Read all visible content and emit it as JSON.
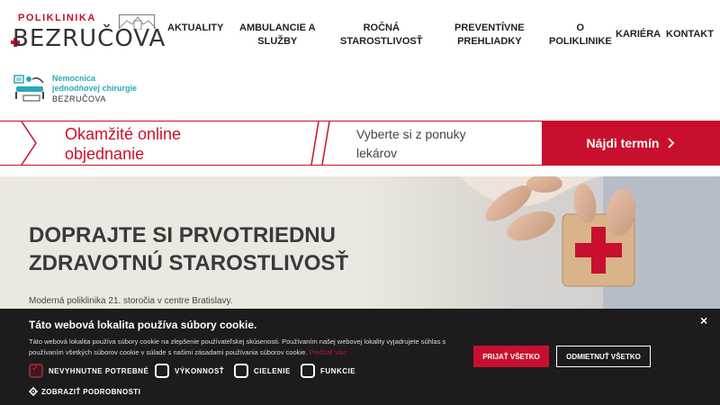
{
  "header": {
    "logo_top": "POLIKLINIKA",
    "logo_main": "BEZRUČOVA",
    "nav": [
      {
        "label": "AKTUALITY"
      },
      {
        "label": "AMBULANCIE A\nSLUŽBY"
      },
      {
        "label": "ROČNÁ\nSTAROSTLIVOSŤ"
      },
      {
        "label": "PREVENTÍVNE\nPREHLIADKY"
      },
      {
        "label": "O\nPOLIKLINIKE"
      },
      {
        "label": "KARIÉRA"
      },
      {
        "label": "KONTAKT"
      }
    ]
  },
  "sublogo": {
    "line1": "Nemocnica",
    "line2": "jednodňovej chirurgie",
    "line3": "BEZRUČOVA"
  },
  "booking": {
    "title": "Okamžité online\nobjednanie",
    "select_label": "Vyberte si z ponuky\nlekárov",
    "button_label": "Nájdi termín",
    "button_icon": "chevron-right-icon"
  },
  "hero": {
    "title": "DOPRAJTE SI PRVOTRIEDNU\nZDRAVOTNÚ STAROSTLIVOSŤ",
    "subtitle": "Moderná poliklinika 21. storočia v centre Bratislavy."
  },
  "cookie": {
    "title": "Táto webová lokalita používa súbory cookie.",
    "text": "Táto webová lokalita používa súbory cookie na zlepšenie používateľskej skúsenosti. Používaním našej webovej lokality vyjadrujete súhlas s používaním všetkých súborov cookie v súlade s našimi zásadami používania súborov cookie.",
    "link": "Prečítať viac",
    "accept_label": "PRIJAŤ VŠETKO",
    "decline_label": "ODMIETNUŤ VŠETKO",
    "options": [
      {
        "label": "NEVYHNUTNE POTREBNÉ",
        "checked": true
      },
      {
        "label": "VÝKONNOSŤ",
        "checked": false
      },
      {
        "label": "CIELENIE",
        "checked": false
      },
      {
        "label": "FUNKCIE",
        "checked": false
      }
    ],
    "details_label": "ZOBRAZIŤ PODROBNOSTI",
    "close_label": "×"
  },
  "colors": {
    "brand_red": "#c8102e",
    "teal": "#2aa8b8",
    "cookie_bg": "#1c1c1c"
  }
}
